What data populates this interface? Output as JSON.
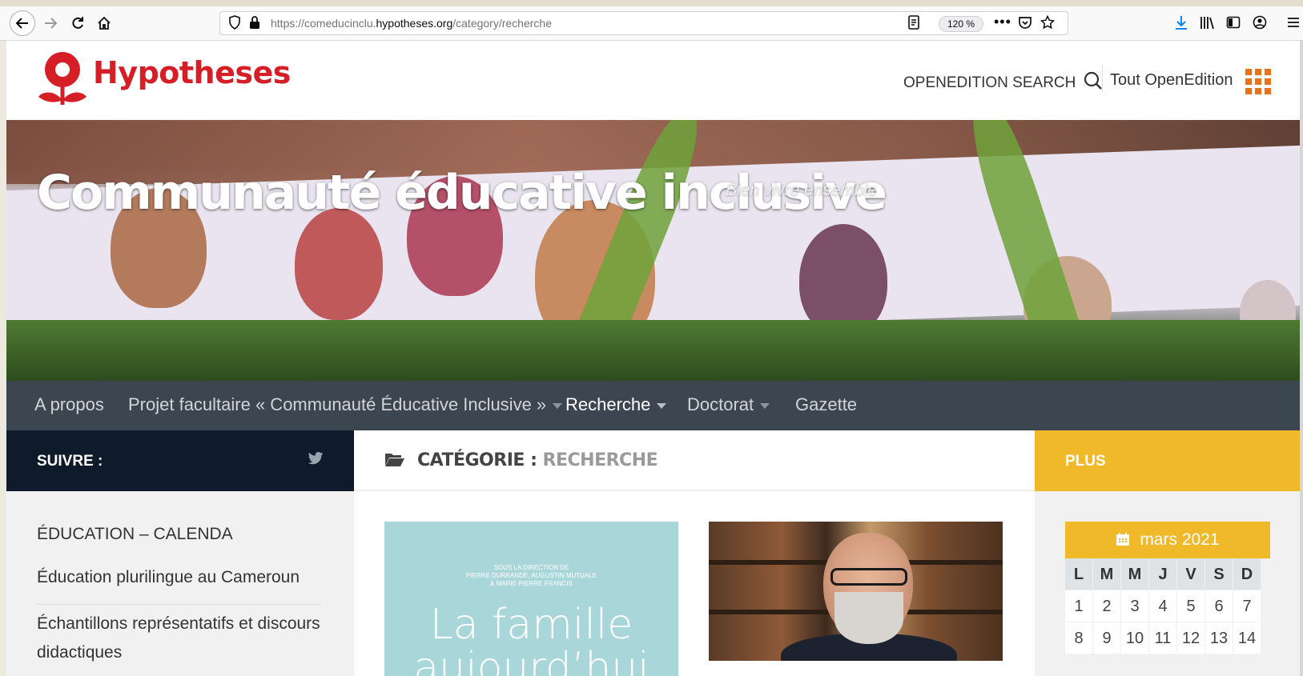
{
  "browser": {
    "url_prefix": "https://comeducinclu.",
    "url_domain": "hypotheses.org",
    "url_path": "/category/recherche",
    "zoom": "120 %"
  },
  "header": {
    "logo_text": "Hypotheses",
    "search_label": "OPENEDITION SEARCH",
    "all_label": "Tout OpenEdition"
  },
  "banner": {
    "title": "Communauté éducative inclusive",
    "tagline": "Bien vivre ensemble"
  },
  "nav": {
    "items": [
      {
        "label": "A propos"
      },
      {
        "label": "Projet facultaire « Communauté Éducative Inclusive »"
      },
      {
        "label": "Recherche"
      },
      {
        "label": "Doctorat"
      },
      {
        "label": "Gazette"
      }
    ]
  },
  "left": {
    "header": "SUIVRE :",
    "links": [
      "ÉDUCATION – CALENDA",
      "Éducation plurilingue au Cameroun",
      "Échantillons représentatifs et discours didactiques"
    ]
  },
  "center": {
    "label_key": "CATÉGORIE :",
    "label_value": "RECHERCHE",
    "card1_small": "SOUS LA DIRECTION DE\nPIERRE DURRANDE, AUGUSTIN MUTUALE\n& MARIE-PIERRE FRANCIS",
    "card1_title": "La famille aujourd’hui"
  },
  "right": {
    "header": "PLUS",
    "calendar": {
      "month": "mars 2021",
      "days": [
        "L",
        "M",
        "M",
        "J",
        "V",
        "S",
        "D"
      ],
      "weeks": [
        [
          "1",
          "2",
          "3",
          "4",
          "5",
          "6",
          "7"
        ],
        [
          "8",
          "9",
          "10",
          "11",
          "12",
          "13",
          "14"
        ]
      ]
    }
  },
  "colors": {
    "brand_red": "#d51e25",
    "nav_bg": "#3b4651",
    "accent_yellow": "#f0b929",
    "follow_bg": "#0f1b2a",
    "grid_orange": "#e8711c"
  }
}
